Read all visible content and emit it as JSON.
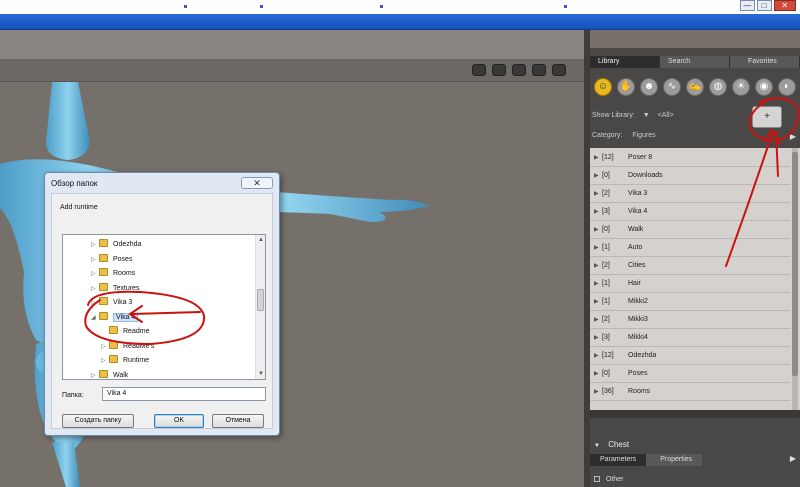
{
  "window": {
    "min_label": "—",
    "max_label": "□",
    "close_label": "✕"
  },
  "library": {
    "tabs": [
      "Library",
      "Search",
      "Favorites"
    ],
    "category_icons": [
      "figure-icon",
      "pose-icon",
      "expression-icon",
      "hair-icon",
      "hand-icon",
      "prop-icon",
      "light-icon",
      "camera-icon",
      "material-icon"
    ],
    "show_label": "Show Library:",
    "show_value": "<All>",
    "category_label": "Category:",
    "category_value": "Figures",
    "add_runtime_glyph": "+",
    "items": [
      {
        "count": "[12]",
        "name": "Poser 8"
      },
      {
        "count": "[0]",
        "name": "Downloads"
      },
      {
        "count": "[2]",
        "name": "Vika 3"
      },
      {
        "count": "[3]",
        "name": "Vika 4"
      },
      {
        "count": "[0]",
        "name": "Walk"
      },
      {
        "count": "[1]",
        "name": "Auto"
      },
      {
        "count": "[2]",
        "name": "Cities"
      },
      {
        "count": "[1]",
        "name": "Hair"
      },
      {
        "count": "[1]",
        "name": "Mikki2"
      },
      {
        "count": "[2]",
        "name": "Mikki3"
      },
      {
        "count": "[3]",
        "name": "Mikki4"
      },
      {
        "count": "[12]",
        "name": "Odezhda"
      },
      {
        "count": "[0]",
        "name": "Poses"
      },
      {
        "count": "[36]",
        "name": "Rooms"
      }
    ]
  },
  "bottom_panel": {
    "title": "Chest",
    "tabs": [
      "Parameters",
      "Properties"
    ],
    "group": "Other"
  },
  "dialog": {
    "title": "Обзор папок",
    "description": "Add runtime",
    "tree": [
      {
        "name": "Odezhda",
        "level": 0,
        "expander": "▷",
        "selected": false
      },
      {
        "name": "Poses",
        "level": 0,
        "expander": "▷",
        "selected": false
      },
      {
        "name": "Rooms",
        "level": 0,
        "expander": "▷",
        "selected": false
      },
      {
        "name": "Textures",
        "level": 0,
        "expander": "▷",
        "selected": false
      },
      {
        "name": "Vika 3",
        "level": 0,
        "expander": "▷",
        "selected": false
      },
      {
        "name": "Vika 4",
        "level": 0,
        "expander": "◢",
        "selected": true
      },
      {
        "name": "Readme",
        "level": 1,
        "expander": "",
        "selected": false
      },
      {
        "name": "ReadMe's",
        "level": 1,
        "expander": "▷",
        "selected": false
      },
      {
        "name": "Runtime",
        "level": 1,
        "expander": "▷",
        "selected": false
      },
      {
        "name": "Walk",
        "level": 0,
        "expander": "▷",
        "selected": false
      }
    ],
    "folder_label": "Папка:",
    "folder_value": "Vika 4",
    "buttons": {
      "new_folder": "Создать папку",
      "ok": "OK",
      "cancel": "Отмена"
    },
    "close_glyph": "✕"
  },
  "colors": {
    "annotation": "#cc1111",
    "figure": "#7cc8e8",
    "active_icon": "#e8b820"
  }
}
